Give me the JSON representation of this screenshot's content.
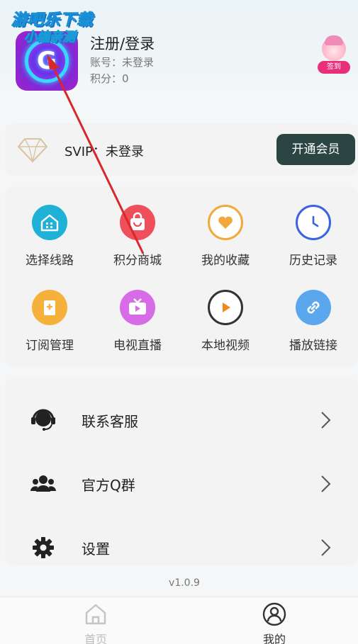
{
  "watermark": {
    "line1": "游吧乐下载",
    "line2": "小编亲测"
  },
  "profile": {
    "app_icon_letter": "G",
    "login_title": "注册/登录",
    "account": "账号：未登录",
    "points": "积分：0",
    "checkin_label": "签到"
  },
  "svip": {
    "label": "SVIP：未登录",
    "button": "开通会员"
  },
  "grid": {
    "items": [
      {
        "label": "选择线路",
        "icon": "home-building-icon",
        "color": "#1fb2d6"
      },
      {
        "label": "积分商城",
        "icon": "shopping-bag-icon",
        "color": "#ee4f5a"
      },
      {
        "label": "我的收藏",
        "icon": "heart-icon",
        "color": "#f2a93b"
      },
      {
        "label": "历史记录",
        "icon": "clock-icon",
        "color": "#3a64e0"
      },
      {
        "label": "订阅管理",
        "icon": "subscribe-icon",
        "color": "#f6b13a"
      },
      {
        "label": "电视直播",
        "icon": "tv-icon",
        "color": "#d86be6"
      },
      {
        "label": "本地视频",
        "icon": "play-circle-icon",
        "color": "#f08a1c"
      },
      {
        "label": "播放链接",
        "icon": "link-icon",
        "color": "#5aa7ee"
      }
    ]
  },
  "list": {
    "items": [
      {
        "label": "联系客服",
        "icon": "headset-icon"
      },
      {
        "label": "官方Q群",
        "icon": "group-icon"
      },
      {
        "label": "设置",
        "icon": "gear-icon"
      }
    ]
  },
  "version": "v1.0.9",
  "nav": {
    "home": {
      "label": "首页",
      "icon": "home-icon"
    },
    "mine": {
      "label": "我的",
      "icon": "user-icon"
    }
  }
}
